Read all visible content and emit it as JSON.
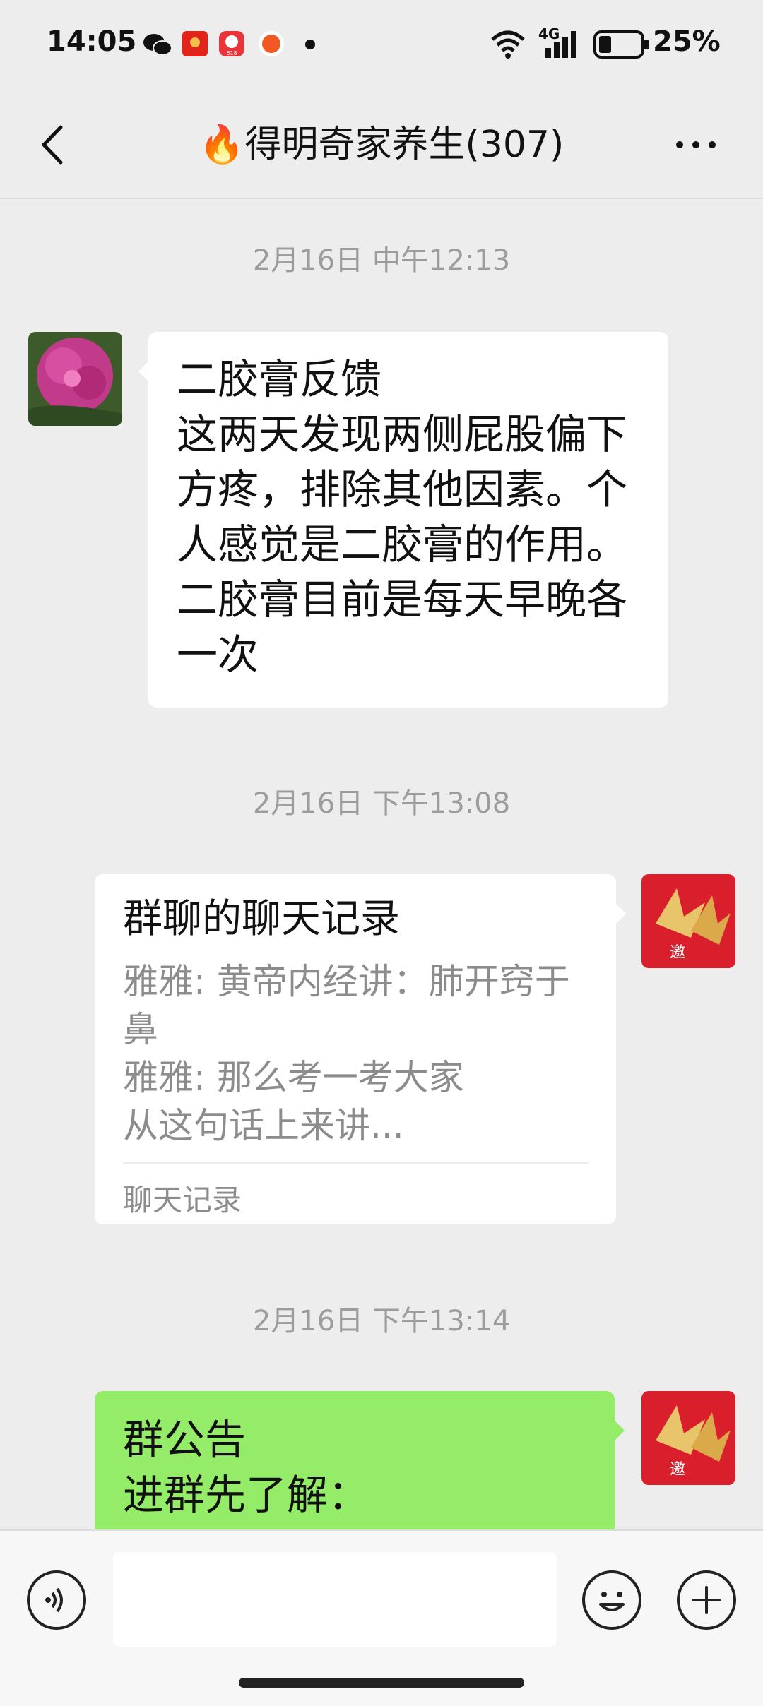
{
  "status_bar": {
    "time": "14:05",
    "network": "4G",
    "battery": "25%",
    "notification_icons": [
      "wechat-icon",
      "red-app-icon",
      "618-app-icon",
      "orange-app-icon",
      "dot-icon"
    ]
  },
  "nav": {
    "title": "🔥得明奇家养生(307)"
  },
  "messages": [
    {
      "timestamp": "2月16日 中午12:13",
      "type": "text",
      "side": "left",
      "text": "二胶膏反馈\n这两天发现两侧屁股偏下\n方疼，排除其他因素。个\n人感觉是二胶膏的作用。\n二胶膏目前是每天早晚各\n一次"
    },
    {
      "timestamp": "2月16日 下午13:08",
      "type": "chat_record",
      "side": "right",
      "title": "群聊的聊天记录",
      "preview": "雅雅: 黄帝内经讲：肺开窍于\n鼻\n雅雅: 那么考一考大家\n从这句话上来讲...",
      "footer": "聊天记录"
    },
    {
      "timestamp": "2月16日 下午13:14",
      "type": "announcement",
      "side": "right",
      "text": "群公告\n进群先了解："
    }
  ],
  "input_bar": {
    "voice_icon": "voice-icon",
    "emoji_icon": "emoji-icon",
    "plus_icon": "plus-icon",
    "placeholder": ""
  },
  "colors": {
    "background": "#ededed",
    "bubble_white": "#ffffff",
    "bubble_green": "#95ec69",
    "timestamp_text": "#9c9c9c"
  }
}
